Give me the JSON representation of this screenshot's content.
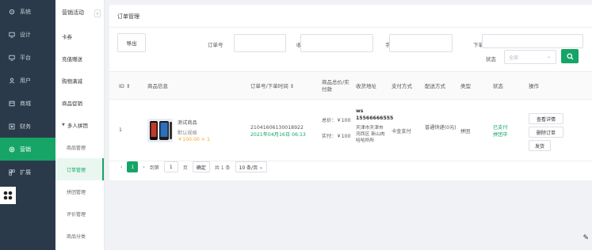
{
  "sidebar": {
    "items": [
      {
        "label": "系统",
        "icon": "settings-icon"
      },
      {
        "label": "设计",
        "icon": "monitor-icon"
      },
      {
        "label": "平台",
        "icon": "monitor-icon"
      },
      {
        "label": "用户",
        "icon": "user-icon"
      },
      {
        "label": "商城",
        "icon": "shop-icon"
      },
      {
        "label": "财务",
        "icon": "finance-icon"
      },
      {
        "label": "营销",
        "icon": "marketing-icon",
        "active": true
      },
      {
        "label": "扩展",
        "icon": "extend-icon"
      }
    ]
  },
  "subnav": {
    "title": "营销活动",
    "collapse_glyph": "«",
    "items": [
      {
        "label": "卡券"
      },
      {
        "label": "充值赠送"
      },
      {
        "label": "购物满减"
      },
      {
        "label": "商品促销"
      },
      {
        "label": "多人拼团",
        "group": true
      },
      {
        "label": "商品管理",
        "child": true
      },
      {
        "label": "订单管理",
        "child": true,
        "active": true
      },
      {
        "label": "拼团管理",
        "child": true
      },
      {
        "label": "评价管理",
        "child": true
      },
      {
        "label": "商品分类",
        "child": true
      }
    ]
  },
  "main": {
    "breadcrumb": "订单管理",
    "export_label": "导出",
    "filters": {
      "order_no_label": "订单号",
      "receiver_label": "收货人",
      "phone_label": "手机号",
      "order_time_label": "下单时间",
      "status_label": "状态",
      "status_value": "全部"
    },
    "table": {
      "headers": [
        "ID",
        "商品信息",
        "订单号/下单时间",
        "商品总价/实付款",
        "收货地址",
        "支付方式",
        "配送方式",
        "类型",
        "状态",
        "操作"
      ],
      "row": {
        "id": "1",
        "product_name": "测试商品",
        "product_spec": "默认规格",
        "product_price": "￥100.00 × 1",
        "order_no": "21041606130018922",
        "order_time": "2021年04月16日 06:13",
        "total": "总价：￥100",
        "paid": "实付：￥100",
        "receiver": "ws 15566666555",
        "address": "天津市天津市河西区 新山肉哈哈所所",
        "payment": "卡金支付",
        "delivery": "普通快递(0元)",
        "type": "拼团",
        "status_line1": "已支付",
        "status_line2": "拼团中",
        "actions": [
          "查看详情",
          "删除订单",
          "发货"
        ]
      }
    },
    "pager": {
      "prev": "‹",
      "current": "1",
      "next": "›",
      "goto_label": "到第",
      "page_input": "1",
      "page_unit": "页",
      "confirm": "确定",
      "total": "共 1 条",
      "page_size": "10 条/页"
    }
  },
  "colors": {
    "accent": "#16a567",
    "sidebar_bg": "#2b3a4a",
    "price": "#f5a623"
  }
}
